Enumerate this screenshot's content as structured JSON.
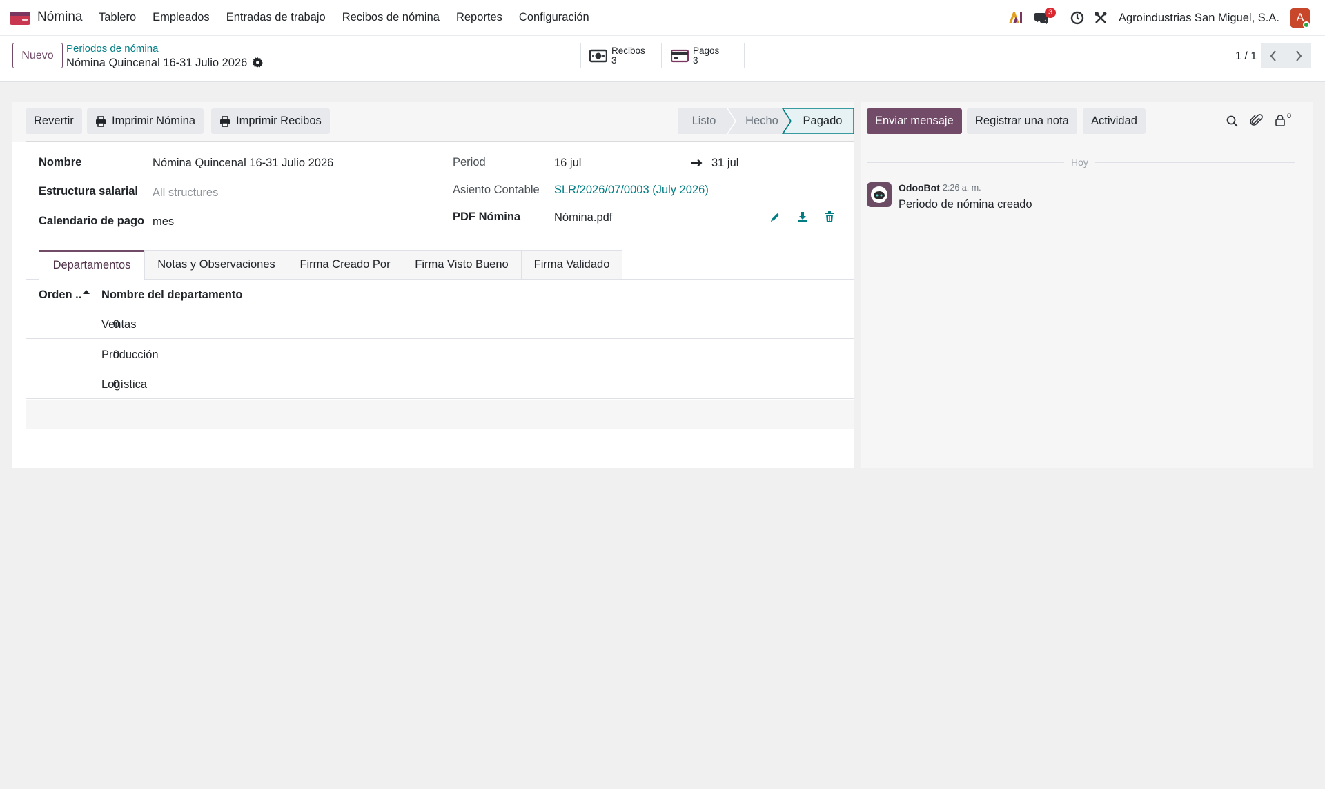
{
  "navbar": {
    "app_name": "Nómina",
    "menu": [
      "Tablero",
      "Empleados",
      "Entradas de trabajo",
      "Recibos de nómina",
      "Reportes",
      "Configuración"
    ],
    "messages_badge": "3",
    "company": "Agroindustrias San Miguel, S.A.",
    "avatar_letter": "A",
    "icons": [
      "ai-icon",
      "messages-icon",
      "clock-icon",
      "tools-icon"
    ]
  },
  "control_panel": {
    "new_button": "Nuevo",
    "breadcrumb_parent": "Periodos de nómina",
    "breadcrumb_current": "Nómina Quincenal 16-31 Julio 2026",
    "smart_buttons": [
      {
        "label": "Recibos",
        "value": "3",
        "icon": "money-icon"
      },
      {
        "label": "Pagos",
        "value": "3",
        "icon": "credit-card-icon"
      }
    ],
    "pager": "1 / 1"
  },
  "statusbar": {
    "buttons": [
      "Revertir",
      "Imprimir Nómina",
      "Imprimir Recibos"
    ],
    "stages": [
      "Listo",
      "Hecho",
      "Pagado"
    ],
    "active_stage": "Pagado"
  },
  "form": {
    "left": [
      {
        "label": "Nombre",
        "value": "Nómina Quincenal 16-31 Julio 2026"
      },
      {
        "label": "Estructura salarial",
        "value": "All structures"
      },
      {
        "label": "Calendario de pago",
        "value": "mes"
      }
    ],
    "period_label": "Period",
    "period_start": "16 jul",
    "period_end": "31 jul",
    "asiento_label": "Asiento Contable",
    "asiento_value": "SLR/2026/07/0003 (July 2026)",
    "pdf_label": "PDF Nómina",
    "pdf_value": "Nómina.pdf"
  },
  "tabs": [
    "Departamentos",
    "Notas y Observaciones",
    "Firma Creado Por",
    "Firma Visto Bueno",
    "Firma Validado"
  ],
  "active_tab": "Departamentos",
  "departments_table": {
    "columns": [
      "Orden ..",
      "Nombre del departamento"
    ],
    "rows": [
      {
        "orden": "0",
        "nombre": "Ventas"
      },
      {
        "orden": "0",
        "nombre": "Producción"
      },
      {
        "orden": "0",
        "nombre": "Logística"
      }
    ]
  },
  "chatter": {
    "buttons": [
      "Enviar mensaje",
      "Registrar una nota",
      "Actividad"
    ],
    "followers_count": "0",
    "date_separator": "Hoy",
    "message": {
      "author": "OdooBot",
      "time": "2:26 a. m.",
      "body": "Periodo de nómina creado"
    }
  },
  "colors": {
    "brand": "#714b67",
    "link": "#017e84",
    "badge": "#d9282f"
  }
}
